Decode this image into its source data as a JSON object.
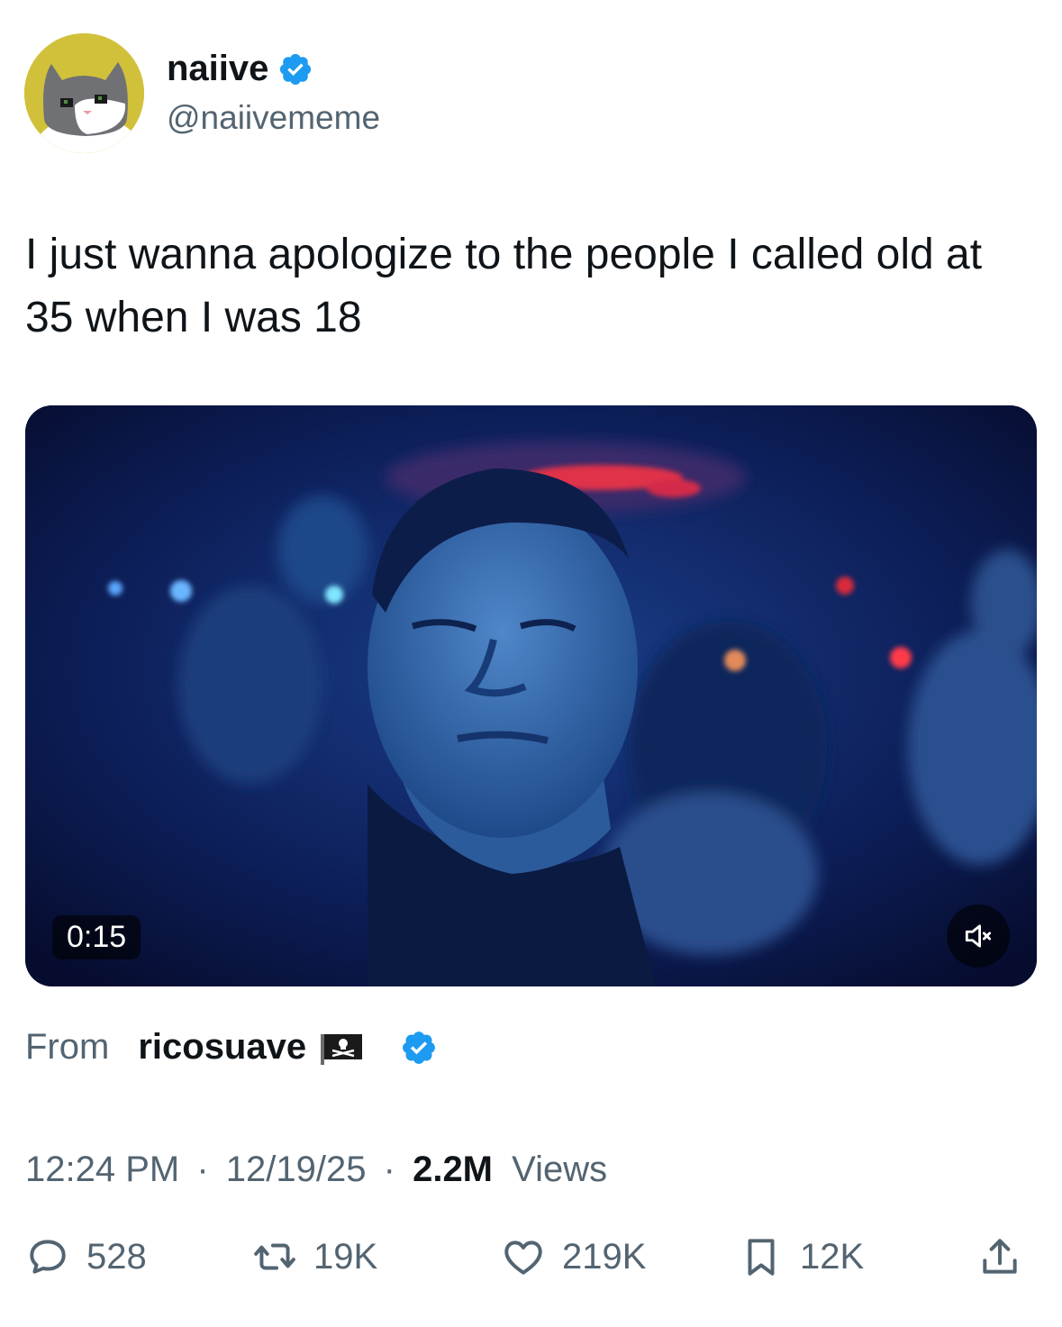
{
  "author": {
    "display_name": "naiive",
    "handle": "@naiivememe",
    "verified": true,
    "avatar_icon": "cat-avatar"
  },
  "tweet": {
    "text": "I just wanna apologize to the people I called old at 35 when I was 18"
  },
  "video": {
    "duration": "0:15",
    "muted": true
  },
  "source": {
    "from_label": "From",
    "name": "ricosuave",
    "flag_icon": "pirate-flag",
    "verified": true
  },
  "meta": {
    "time": "12:24 PM",
    "date": "12/19/25",
    "views_count": "2.2M",
    "views_label": "Views",
    "separator": "·"
  },
  "actions": {
    "replies": "528",
    "reposts": "19K",
    "likes": "219K",
    "bookmarks": "12K"
  },
  "colors": {
    "text_primary": "#0f1419",
    "text_secondary": "#536471",
    "verified_blue": "#1d9bf0",
    "avatar_bg": "#d1c13a"
  }
}
